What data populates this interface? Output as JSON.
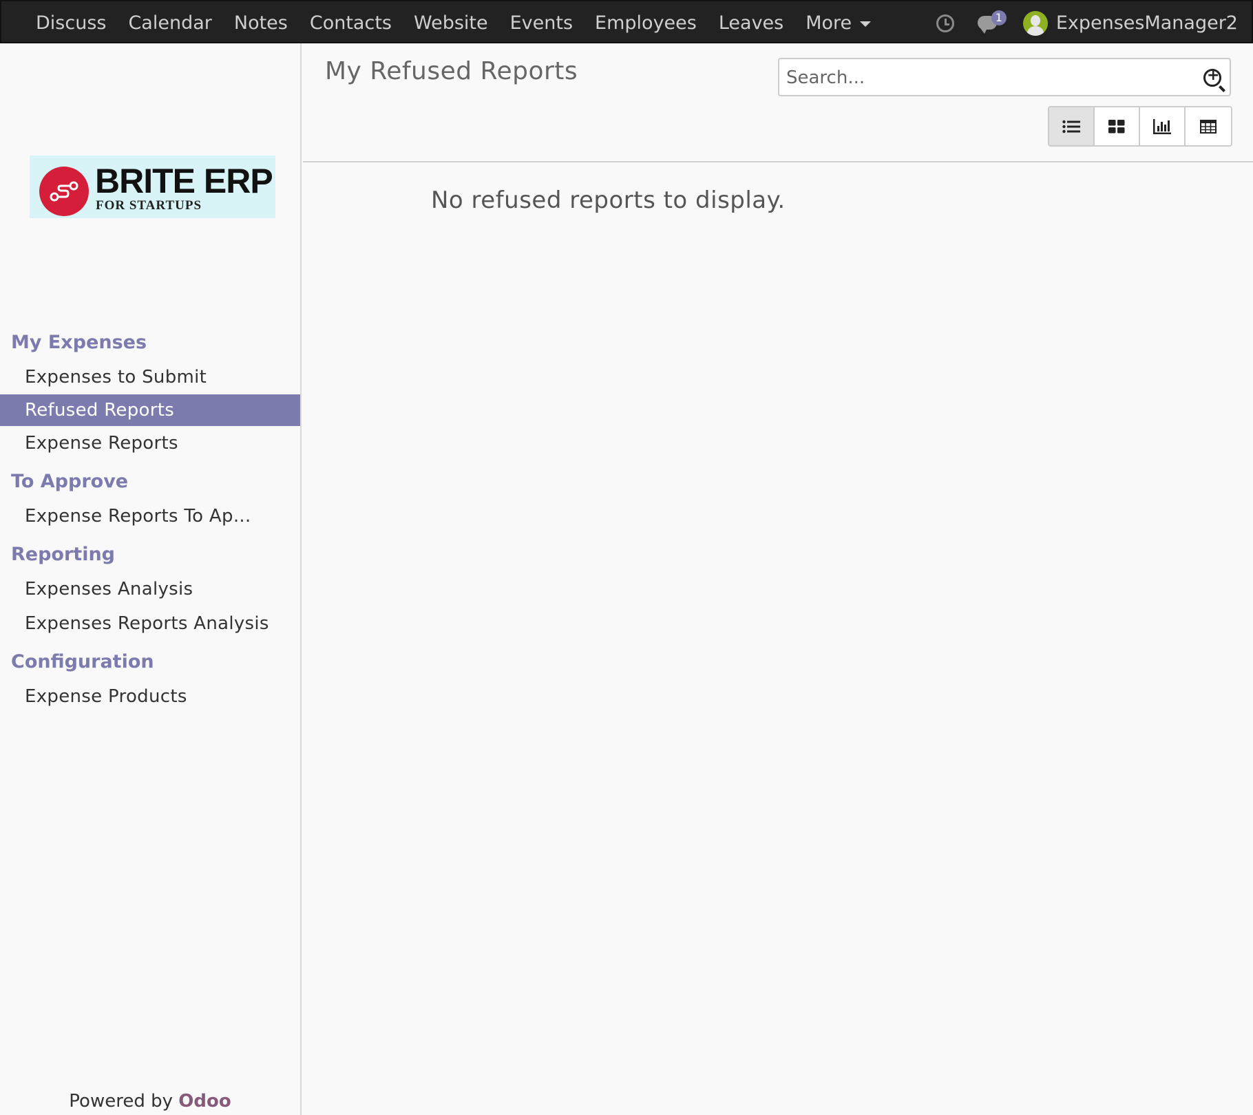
{
  "topbar": {
    "menu": [
      "Discuss",
      "Calendar",
      "Notes",
      "Contacts",
      "Website",
      "Events",
      "Employees",
      "Leaves"
    ],
    "more_label": "More",
    "chat_badge": "1",
    "username": "ExpensesManager2"
  },
  "logo": {
    "main": "BRITE ERP",
    "sub": "FOR STARTUPS"
  },
  "sidebar": {
    "sections": [
      {
        "title": "My Expenses",
        "items": [
          "Expenses to Submit",
          "Refused Reports",
          "Expense Reports"
        ]
      },
      {
        "title": "To Approve",
        "items": [
          "Expense Reports To Ap..."
        ]
      },
      {
        "title": "Reporting",
        "items": [
          "Expenses Analysis",
          "Expenses Reports Analysis"
        ]
      },
      {
        "title": "Configuration",
        "items": [
          "Expense Products"
        ]
      }
    ],
    "active_item": "Refused Reports",
    "powered_by": "Powered by",
    "powered_brand": "Odoo"
  },
  "main": {
    "title": "My Refused Reports",
    "search_placeholder": "Search...",
    "views": [
      "list-view-icon",
      "kanban-view-icon",
      "graph-view-icon",
      "pivot-view-icon"
    ],
    "active_view": "list",
    "empty_message": "No refused reports to display."
  },
  "colors": {
    "accent": "#7c7bad",
    "topbar": "#222222",
    "brand_odoo": "#875a7b",
    "logo_red": "#d51f3a"
  }
}
